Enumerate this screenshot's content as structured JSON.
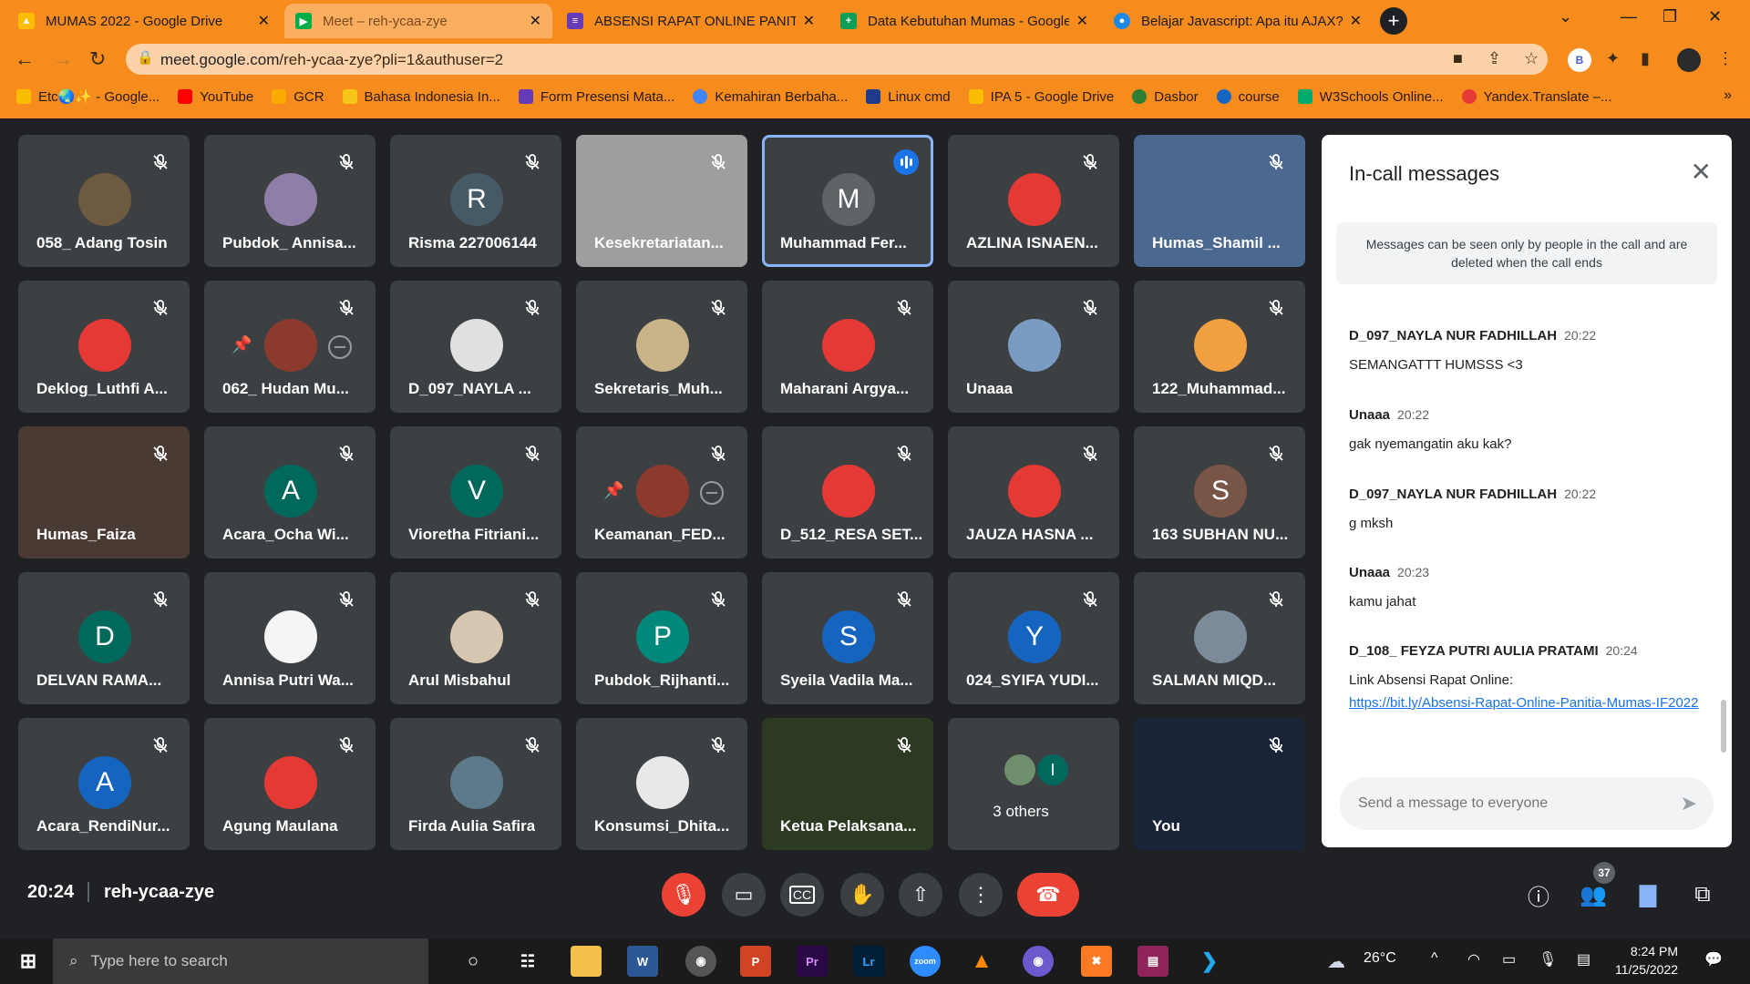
{
  "browser": {
    "tabs": [
      {
        "title": "MUMAS 2022 - Google Drive",
        "favicon": "google-drive-icon",
        "color": "#fbbc04"
      },
      {
        "title": "Meet – reh-ycaa-zye",
        "favicon": "google-meet-icon",
        "color": "#00ac47",
        "active": true
      },
      {
        "title": "ABSENSI RAPAT ONLINE PANITIA",
        "favicon": "google-forms-icon",
        "color": "#673ab7"
      },
      {
        "title": "Data Kebutuhan Mumas - Google",
        "favicon": "google-sheets-icon",
        "color": "#0f9d58"
      },
      {
        "title": "Belajar Javascript: Apa itu AJAX? |",
        "favicon": "site-icon",
        "color": "#1e88e5"
      }
    ],
    "url_host": "meet.google.com",
    "url_path": "/reh-ycaa-zye?pli=1&authuser=2",
    "profile_initial": "B",
    "bookmarks": [
      {
        "label": "Etc🌏✨ - Google...",
        "color": "#fbbc04"
      },
      {
        "label": "YouTube",
        "color": "#ff0000"
      },
      {
        "label": "GCR",
        "color": "#f9ab00"
      },
      {
        "label": "Bahasa Indonesia In...",
        "color": "#f5c518"
      },
      {
        "label": "Form Presensi Mata...",
        "color": "#673ab7"
      },
      {
        "label": "Kemahiran Berbaha...",
        "color": "#4285f4"
      },
      {
        "label": "Linux cmd",
        "color": "#1e3a8a"
      },
      {
        "label": "IPA 5 - Google Drive",
        "color": "#fbbc04"
      },
      {
        "label": "Dasbor",
        "color": "#2e7d32"
      },
      {
        "label": "course",
        "color": "#1565c0"
      },
      {
        "label": "W3Schools Online...",
        "color": "#04aa6d"
      },
      {
        "label": "Yandex.Translate –...",
        "color": "#e53935"
      }
    ],
    "more_bookmarks": "»"
  },
  "participants": [
    {
      "name": "058_ Adang Tosin",
      "avatar": "photo",
      "color": "#6d5a40"
    },
    {
      "name": "Pubdok_ Annisa...",
      "avatar": "photo",
      "color": "#8e7fa8"
    },
    {
      "name": "Risma 227006144",
      "avatar": "R",
      "color": "#455a64"
    },
    {
      "name": "Kesekretariatan...",
      "avatar": "video",
      "color": "#9e9e9e"
    },
    {
      "name": "Muhammad Fer...",
      "avatar": "M",
      "color": "#5f6368",
      "speaking": true
    },
    {
      "name": "AZLINA ISNAEN...",
      "avatar": "photo",
      "color": "#e53935"
    },
    {
      "name": "Humas_Shamil ...",
      "avatar": "video",
      "color": "#4a6890"
    },
    {
      "name": "Deklog_Luthfi A...",
      "avatar": "photo",
      "color": "#e53935"
    },
    {
      "name": "062_ Hudan Mu...",
      "avatar": "photo",
      "color": "#8d3a2e",
      "pinned": true
    },
    {
      "name": "D_097_NAYLA ...",
      "avatar": "photo",
      "color": "#e0e0e0"
    },
    {
      "name": "Sekretaris_Muh...",
      "avatar": "photo",
      "color": "#c9b48a"
    },
    {
      "name": "Maharani Argya...",
      "avatar": "photo",
      "color": "#e53935"
    },
    {
      "name": "Unaaa",
      "avatar": "photo",
      "color": "#7a9cc2"
    },
    {
      "name": "122_Muhammad...",
      "avatar": "photo",
      "color": "#f0a040"
    },
    {
      "name": "Humas_Faiza",
      "avatar": "video",
      "color": "#4a3a34"
    },
    {
      "name": "Acara_Ocha Wi...",
      "avatar": "A",
      "color": "#00695c"
    },
    {
      "name": "Vioretha Fitriani...",
      "avatar": "V",
      "color": "#00695c"
    },
    {
      "name": "Keamanan_FED...",
      "avatar": "photo",
      "color": "#8d3a2e",
      "pinned": true
    },
    {
      "name": "D_512_RESA SET...",
      "avatar": "photo",
      "color": "#e53935"
    },
    {
      "name": "JAUZA HASNA ...",
      "avatar": "photo",
      "color": "#e53935"
    },
    {
      "name": "163 SUBHAN NU...",
      "avatar": "S",
      "color": "#795548"
    },
    {
      "name": "DELVAN RAMA...",
      "avatar": "D",
      "color": "#00695c"
    },
    {
      "name": "Annisa Putri Wa...",
      "avatar": "photo",
      "color": "#f5f5f5"
    },
    {
      "name": "Arul Misbahul",
      "avatar": "photo",
      "color": "#d8c7b0"
    },
    {
      "name": "Pubdok_Rijhanti...",
      "avatar": "P",
      "color": "#00897b"
    },
    {
      "name": "Syeila Vadila Ma...",
      "avatar": "S",
      "color": "#1565c0"
    },
    {
      "name": "024_SYIFA YUDI...",
      "avatar": "Y",
      "color": "#1565c0"
    },
    {
      "name": "SALMAN MIQD...",
      "avatar": "photo",
      "color": "#7d8a99"
    },
    {
      "name": "Acara_RendiNur...",
      "avatar": "A",
      "color": "#1565c0"
    },
    {
      "name": "Agung Maulana",
      "avatar": "photo",
      "color": "#e53935"
    },
    {
      "name": "Firda Aulia Safira",
      "avatar": "photo",
      "color": "#5d7a8a"
    },
    {
      "name": "Konsumsi_Dhita...",
      "avatar": "photo",
      "color": "#e8e8e8"
    },
    {
      "name": "Ketua Pelaksana...",
      "avatar": "video",
      "color": "#2c3a22"
    },
    {
      "name": "3 others",
      "avatar": "others",
      "color": "#3c4043"
    },
    {
      "name": "You",
      "avatar": "video",
      "color": "#1a2438"
    }
  ],
  "others_initial": "I",
  "chat": {
    "title": "In-call messages",
    "notice": "Messages can be seen only by people in the call and are deleted when the call ends",
    "messages": [
      {
        "sender": "D_097_NAYLA NUR FADHILLAH",
        "time": "20:22",
        "text": "SEMANGATTT HUMSSS <3"
      },
      {
        "sender": "Unaaa",
        "time": "20:22",
        "text": "gak nyemangatin aku kak?"
      },
      {
        "sender": "D_097_NAYLA NUR FADHILLAH",
        "time": "20:22",
        "text": "g mksh"
      },
      {
        "sender": "Unaaa",
        "time": "20:23",
        "text": "kamu jahat"
      },
      {
        "sender": "D_108_ FEYZA PUTRI AULIA PRATAMI",
        "time": "20:24",
        "text": "Link Absensi Rapat Online:",
        "link": "https://bit.ly/Absensi-Rapat-Online-Panitia-Mumas-IF2022"
      }
    ],
    "input_placeholder": "Send a message to everyone"
  },
  "meeting": {
    "time": "20:24",
    "code": "reh-ycaa-zye",
    "participant_count": "37"
  },
  "taskbar": {
    "search_placeholder": "Type here to search",
    "weather": "26°C",
    "clock_time": "8:24 PM",
    "clock_date": "11/25/2022"
  }
}
